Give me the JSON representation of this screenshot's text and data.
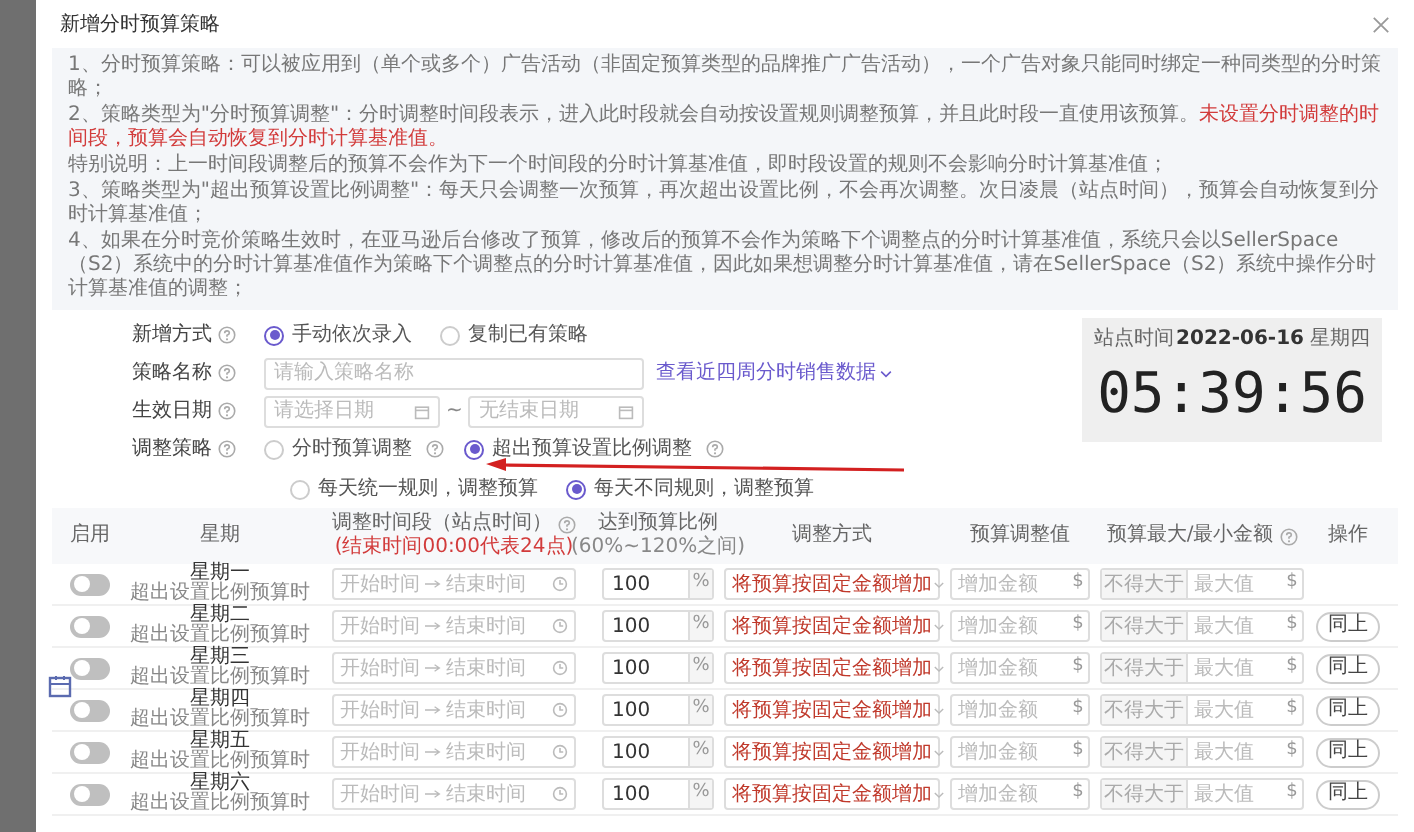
{
  "dialog": {
    "title": "新增分时预算策略"
  },
  "notes": [
    {
      "text": "1、分时预算策略：可以被应用到（单个或多个）广告活动（非固定预算类型的品牌推广广告活动），一个广告对象只能同时绑定一种同类型的分时策略；"
    },
    {
      "text": "2、策略类型为\"分时预算调整\"：分时调整时间段表示，进入此时段就会自动按设置规则调整预算，并且此时段一直使用该预算。",
      "alert": "未设置分时调整的时间段，预算会自动恢复到分时计算基准值。"
    },
    {
      "text": "特别说明：上一时间段调整后的预算不会作为下一个时间段的分时计算基准值，即时段设置的规则不会影响分时计算基准值；"
    },
    {
      "text": "3、策略类型为\"超出预算设置比例调整\"：每天只会调整一次预算，再次超出设置比例，不会再次调整。次日凌晨（站点时间），预算会自动恢复到分时计算基准值；"
    },
    {
      "text": "4、如果在分时竞价策略生效时，在亚马逊后台修改了预算，修改后的预算不会作为策略下个调整点的分时计算基准值，系统只会以SellerSpace（S2）系统中的分时计算基准值作为策略下个调整点的分时计算基准值，因此如果想调整分时计算基准值，请在SellerSpace（S2）系统中操作分时计算基准值的调整；"
    }
  ],
  "form": {
    "add_mode": {
      "label": "新增方式",
      "options": [
        {
          "label": "手动依次录入",
          "selected": true
        },
        {
          "label": "复制已有策略",
          "selected": false
        }
      ]
    },
    "name": {
      "label": "策略名称",
      "placeholder": "请输入策略名称",
      "link": "查看近四周分时销售数据"
    },
    "dates": {
      "label": "生效日期",
      "start_placeholder": "请选择日期",
      "separator": "~",
      "end_placeholder": "无结束日期"
    },
    "strategy": {
      "label": "调整策略",
      "options": [
        {
          "label": "分时预算调整",
          "selected": false
        },
        {
          "label": "超出预算设置比例调整",
          "selected": true
        }
      ],
      "sub_options": [
        {
          "label": "每天统一规则，调整预算",
          "selected": false
        },
        {
          "label": "每天不同规则，调整预算",
          "selected": true
        }
      ]
    }
  },
  "clock": {
    "label": "站点时间",
    "date": "2022-06-16",
    "weekday": "星期四",
    "time": "05:39:56"
  },
  "table": {
    "columns": [
      {
        "lines": [
          "启用"
        ]
      },
      {
        "lines": [
          "星期"
        ]
      },
      {
        "lines": [
          "调整时间段（站点时间）",
          "(结束时间00:00代表24点)"
        ],
        "help": true
      },
      {
        "lines": [
          "达到预算比例",
          "(60%~120%之间)"
        ]
      },
      {
        "lines": [
          "调整方式"
        ]
      },
      {
        "lines": [
          "预算调整值"
        ]
      },
      {
        "lines": [
          "预算最大/最小金额"
        ],
        "help": true
      },
      {
        "lines": [
          "操作"
        ]
      }
    ],
    "rows": [
      {
        "enabled": false,
        "day": "星期一",
        "note": "超出设置比例预算时",
        "start": "开始时间",
        "end": "结束时间",
        "ratio": "100",
        "unit": "%",
        "method": "将预算按固定金额增加",
        "amount": "增加金额",
        "currency": "$",
        "limit": "不得大于",
        "max": "最大值",
        "max_currency": "$"
      },
      {
        "enabled": false,
        "day": "星期二",
        "note": "超出设置比例预算时",
        "start": "开始时间",
        "end": "结束时间",
        "ratio": "100",
        "unit": "%",
        "method": "将预算按固定金额增加",
        "amount": "增加金额",
        "currency": "$",
        "limit": "不得大于",
        "max": "最大值",
        "max_currency": "$",
        "action": "同上"
      },
      {
        "enabled": false,
        "day": "星期三",
        "note": "超出设置比例预算时",
        "start": "开始时间",
        "end": "结束时间",
        "ratio": "100",
        "unit": "%",
        "method": "将预算按固定金额增加",
        "amount": "增加金额",
        "currency": "$",
        "limit": "不得大于",
        "max": "最大值",
        "max_currency": "$",
        "action": "同上"
      },
      {
        "enabled": false,
        "day": "星期四",
        "note": "超出设置比例预算时",
        "start": "开始时间",
        "end": "结束时间",
        "ratio": "100",
        "unit": "%",
        "method": "将预算按固定金额增加",
        "amount": "增加金额",
        "currency": "$",
        "limit": "不得大于",
        "max": "最大值",
        "max_currency": "$",
        "action": "同上"
      },
      {
        "enabled": false,
        "day": "星期五",
        "note": "超出设置比例预算时",
        "start": "开始时间",
        "end": "结束时间",
        "ratio": "100",
        "unit": "%",
        "method": "将预算按固定金额增加",
        "amount": "增加金额",
        "currency": "$",
        "limit": "不得大于",
        "max": "最大值",
        "max_currency": "$",
        "action": "同上"
      },
      {
        "enabled": false,
        "day": "星期六",
        "note": "超出设置比例预算时",
        "start": "开始时间",
        "end": "结束时间",
        "ratio": "100",
        "unit": "%",
        "method": "将预算按固定金额增加",
        "amount": "增加金额",
        "currency": "$",
        "limit": "不得大于",
        "max": "最大值",
        "max_currency": "$",
        "action": "同上"
      }
    ]
  }
}
